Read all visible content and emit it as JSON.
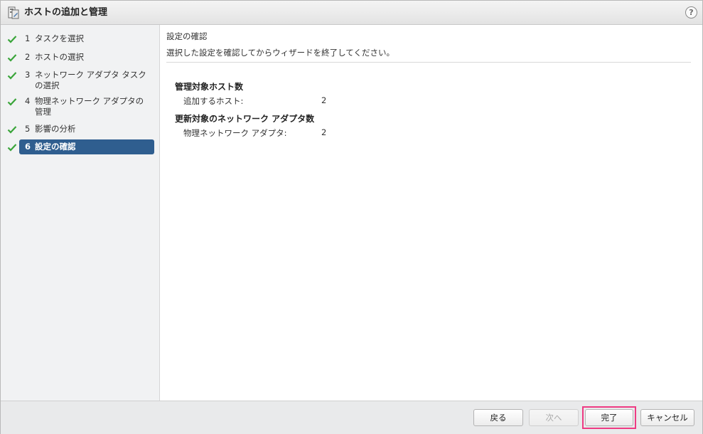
{
  "dialog": {
    "title": "ホストの追加と管理",
    "help": "?"
  },
  "nav": {
    "steps": [
      {
        "num": "1",
        "label": "タスクを選択",
        "completed": true,
        "active": false
      },
      {
        "num": "2",
        "label": "ホストの選択",
        "completed": true,
        "active": false
      },
      {
        "num": "3",
        "label": "ネットワーク アダプタ タスク",
        "label2": "の選択",
        "completed": true,
        "active": false
      },
      {
        "num": "4",
        "label": "物理ネットワーク アダプタの",
        "label2": "管理",
        "completed": true,
        "active": false
      },
      {
        "num": "5",
        "label": "影響の分析",
        "completed": true,
        "active": false
      },
      {
        "num": "6",
        "label": "設定の確認",
        "completed": true,
        "active": true
      }
    ]
  },
  "content": {
    "title": "設定の確認",
    "description": "選択した設定を確認してからウィザードを終了してください。",
    "groups": [
      {
        "title": "管理対象ホスト数",
        "rows": [
          {
            "label": "追加するホスト:",
            "value": "2"
          }
        ]
      },
      {
        "title": "更新対象のネットワーク アダプタ数",
        "rows": [
          {
            "label": "物理ネットワーク アダプタ:",
            "value": "2"
          }
        ]
      }
    ]
  },
  "footer": {
    "back_label": "戻る",
    "next_label": "次へ",
    "finish_label": "完了",
    "cancel_label": "キャンセル"
  },
  "colors": {
    "active_step": "#2f5e8f",
    "check": "#3aa53a",
    "highlight": "#ee3b83"
  }
}
